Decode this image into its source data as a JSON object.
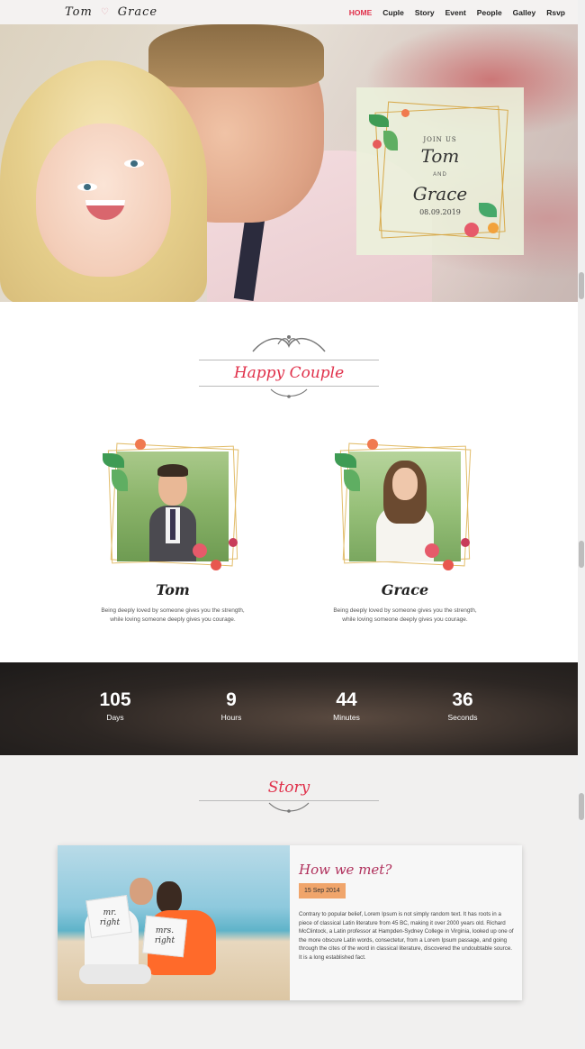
{
  "nav": {
    "brand_first": "Tom",
    "brand_second": "Grace",
    "menu": [
      "HOME",
      "Cuple",
      "Story",
      "Event",
      "People",
      "Galley",
      "Rsvp"
    ]
  },
  "hero": {
    "join": "JOIN US",
    "name1": "Tom",
    "and": "AND",
    "name2": "Grace",
    "date": "08.09.2019"
  },
  "couple": {
    "title": "Happy Couple",
    "groom": {
      "name": "Tom",
      "desc_line1": "Being deeply loved by someone gives you the strength,",
      "desc_line2": "while loving someone deeply gives you courage."
    },
    "bride": {
      "name": "Grace",
      "desc_line1": "Being deeply loved by someone gives you the strength,",
      "desc_line2": "while loving someone deeply gives you courage."
    }
  },
  "countdown": [
    {
      "value": "105",
      "label": "Days"
    },
    {
      "value": "9",
      "label": "Hours"
    },
    {
      "value": "44",
      "label": "Minutes"
    },
    {
      "value": "36",
      "label": "Seconds"
    }
  ],
  "story": {
    "title": "Story",
    "card_title": "How we met?",
    "date": "15 Sep 2014",
    "text": "Contrary to popular belief, Lorem Ipsum is not simply random text. It has roots in a piece of classical Latin literature from 45 BC, making it over 2000 years old. Richard McClintock, a Latin professor at Hampden-Sydney College in Virginia, looked up one of the more obscure Latin words, consectetur, from a Lorem Ipsum passage, and going through the cites of the word in classical literature, discovered the undoubtable source. It is a long established fact.",
    "pillow_left": "mr. right",
    "pillow_right": "mrs. right"
  },
  "colors": {
    "accent": "#e0304a",
    "gold": "#d7a94a",
    "date_badge": "#f0a56b"
  }
}
